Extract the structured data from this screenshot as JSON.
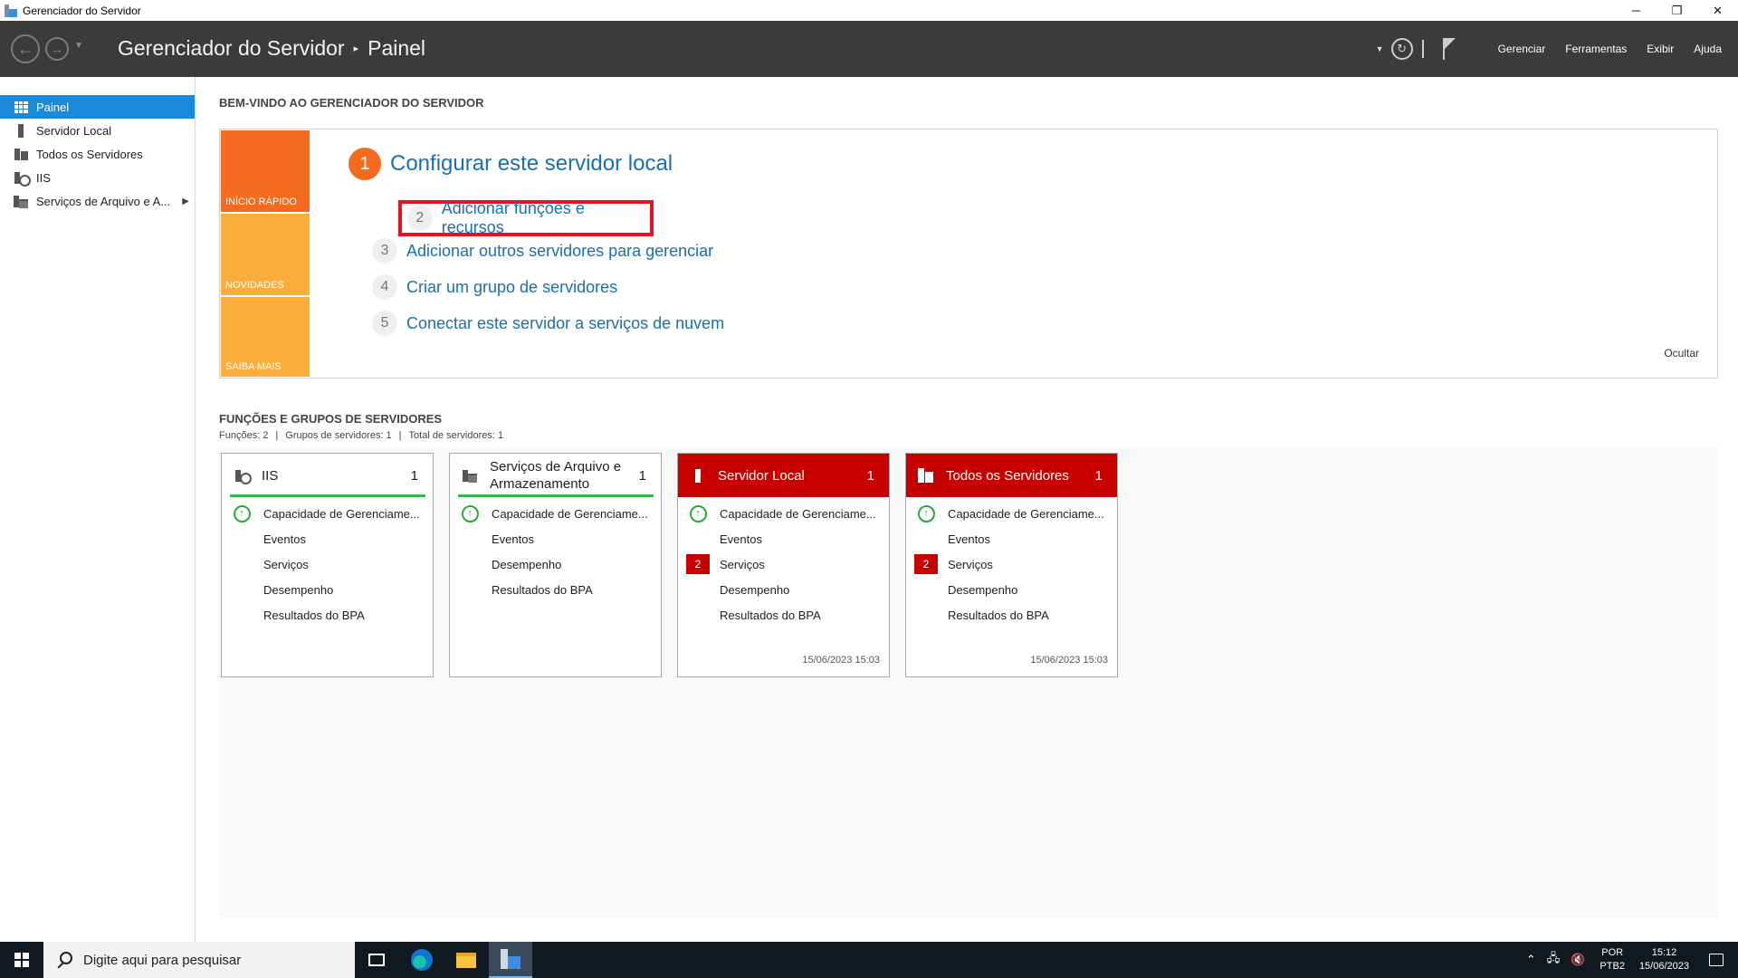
{
  "window": {
    "title": "Gerenciador do Servidor",
    "minimize": "─",
    "restore": "❐",
    "close": "✕"
  },
  "header": {
    "app_name": "Gerenciador do Servidor",
    "separator": "▸",
    "page": "Painel",
    "menu": [
      "Gerenciar",
      "Ferramentas",
      "Exibir",
      "Ajuda"
    ]
  },
  "sidebar": {
    "items": [
      {
        "label": "Painel",
        "icon": "dashboard-icon",
        "active": true
      },
      {
        "label": "Servidor Local",
        "icon": "server-icon"
      },
      {
        "label": "Todos os Servidores",
        "icon": "servers-icon"
      },
      {
        "label": "IIS",
        "icon": "iis-icon"
      },
      {
        "label": "Serviços de Arquivo e A...",
        "icon": "file-services-icon",
        "expand": "▶"
      }
    ]
  },
  "welcome": {
    "title": "BEM-VINDO AO GERENCIADOR DO SERVIDOR",
    "tiles": [
      "INÍCIO RÁPIDO",
      "NOVIDADES",
      "SAIBA MAIS"
    ],
    "step1": {
      "num": "1",
      "label": "Configurar este servidor local"
    },
    "steps": [
      {
        "num": "2",
        "label": "Adicionar funções e recursos"
      },
      {
        "num": "3",
        "label": "Adicionar outros servidores para gerenciar"
      },
      {
        "num": "4",
        "label": "Criar um grupo de servidores"
      },
      {
        "num": "5",
        "label": "Conectar este servidor a serviços de nuvem"
      }
    ],
    "hide": "Ocultar"
  },
  "roles": {
    "title": "FUNÇÕES E GRUPOS DE SERVIDORES",
    "functions": "Funções: 2",
    "groups": "Grupos de servidores: 1",
    "total": "Total de servidores: 1",
    "cards": [
      {
        "title": "IIS",
        "count": "1",
        "style": "white",
        "rows": [
          "Capacidade de Gerenciame...",
          "Eventos",
          "Serviços",
          "Desempenho",
          "Resultados do BPA"
        ],
        "timestamp": ""
      },
      {
        "title": "Serviços de Arquivo e Armazenamento",
        "count": "1",
        "style": "white",
        "rows": [
          "Capacidade de Gerenciame...",
          "Eventos",
          "Desempenho",
          "Resultados do BPA"
        ],
        "timestamp": ""
      },
      {
        "title": "Servidor Local",
        "count": "1",
        "style": "red",
        "rows": [
          "Capacidade de Gerenciame...",
          "Eventos",
          "Serviços",
          "Desempenho",
          "Resultados do BPA"
        ],
        "services_badge": "2",
        "timestamp": "15/06/2023 15:03"
      },
      {
        "title": "Todos os Servidores",
        "count": "1",
        "style": "red",
        "rows": [
          "Capacidade de Gerenciame...",
          "Eventos",
          "Serviços",
          "Desempenho",
          "Resultados do BPA"
        ],
        "services_badge": "2",
        "timestamp": "15/06/2023 15:03"
      }
    ]
  },
  "taskbar": {
    "search_placeholder": "Digite aqui para pesquisar",
    "lang_1": "POR",
    "lang_2": "PTB2",
    "time": "15:12",
    "date": "15/06/2023"
  },
  "colors": {
    "header_bg": "#3b3b3b",
    "accent_blue": "#1a8adb",
    "quick_start_orange": "#f46b1f",
    "tile_yellow": "#fbae3c",
    "alert_red": "#c70000",
    "ok_green": "#36b84a",
    "highlight_red": "#e81123"
  }
}
